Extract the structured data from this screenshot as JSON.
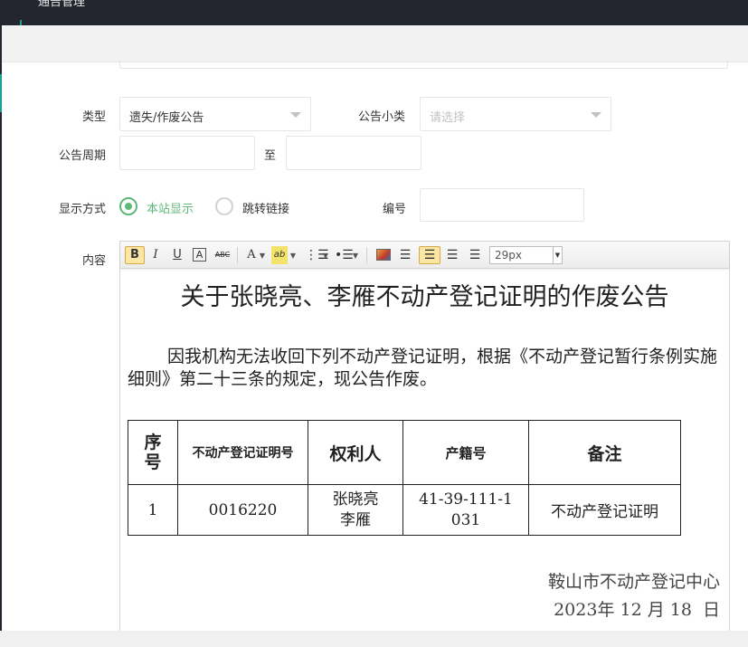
{
  "header": {
    "title": "通告管理"
  },
  "form": {
    "type_label": "类型",
    "type_value": "遗失/作废公告",
    "subtype_label": "公告小类",
    "subtype_placeholder": "请选择",
    "period_label": "公告周期",
    "period_sep": "至",
    "period_start": "",
    "period_end": "",
    "display_label": "显示方式",
    "display_options": [
      {
        "label": "本站显示",
        "selected": true
      },
      {
        "label": "跳转链接",
        "selected": false
      }
    ],
    "number_label": "编号",
    "number_value": "",
    "content_label": "内容"
  },
  "editor": {
    "toolbar": {
      "bold": "B",
      "italic": "I",
      "underline": "U",
      "border": "A",
      "strike": "ABC",
      "font_color": "A",
      "highlight": "ab",
      "font_size": "29px"
    },
    "document": {
      "title": "关于张晓亮、李雁不动产登记证明的作废公告",
      "paragraph": "因我机构无法收回下列不动产登记证明，根据《不动产登记暂行条例实施细则》第二十三条的规定，现公告作废。",
      "table": {
        "headers": [
          "序号",
          "不动产登记证明号",
          "权利人",
          "产籍号",
          "备注"
        ],
        "rows": [
          [
            "1",
            "0016220",
            "张晓亮\n李雁",
            "41-39-111-1031",
            "不动产登记证明"
          ]
        ]
      },
      "signature_org": "鞍山市不动产登记中心",
      "signature_date": "2023年 12 月 18  日"
    }
  },
  "colors": {
    "accent": "#5fb878",
    "sidebar": "#23262e",
    "teal": "#1aa094"
  }
}
